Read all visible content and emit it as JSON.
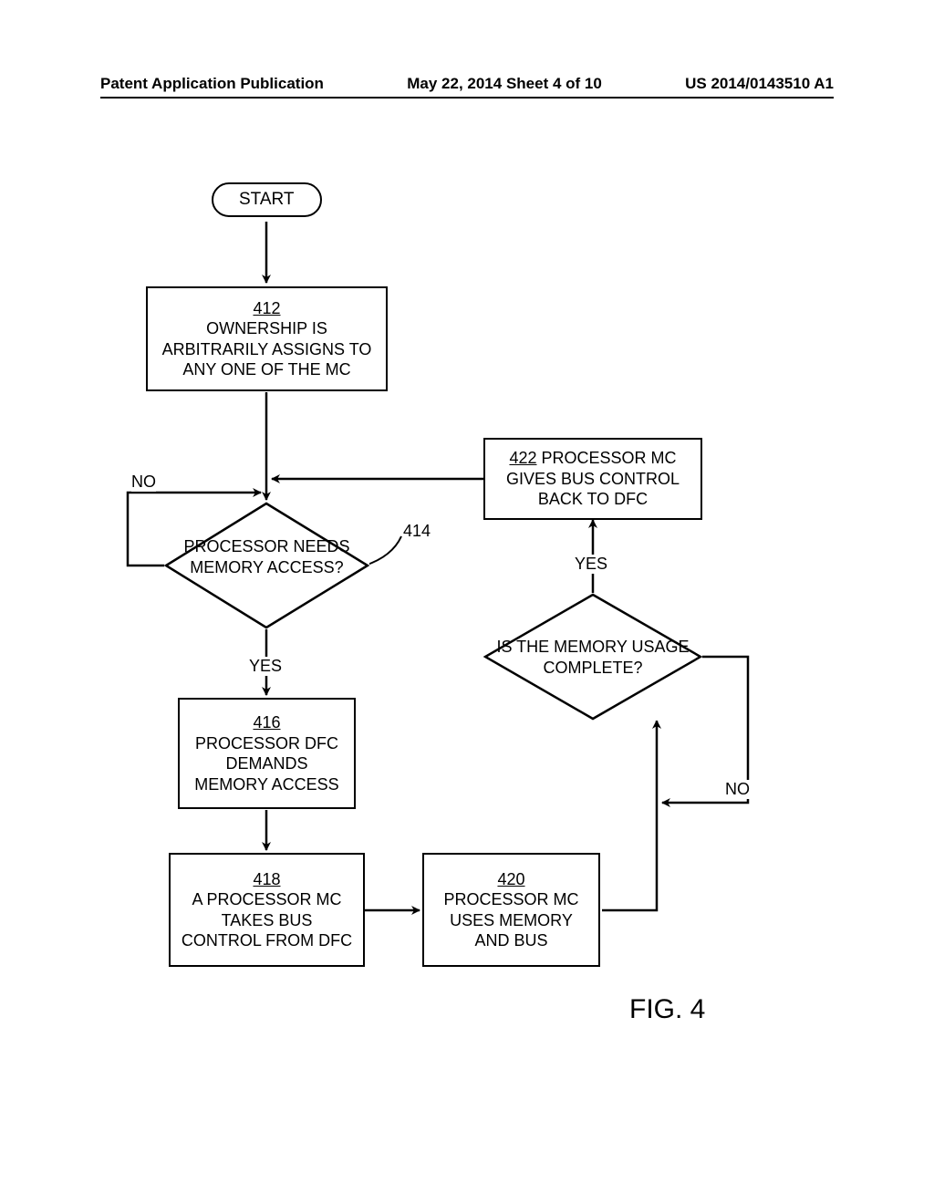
{
  "header": {
    "left": "Patent Application Publication",
    "center": "May 22, 2014  Sheet 4 of 10",
    "right": "US 2014/0143510 A1"
  },
  "start": {
    "label": "START"
  },
  "box412": {
    "ref": "412",
    "text": "OWNERSHIP IS ARBITRARILY ASSIGNS TO ANY ONE OF THE MC"
  },
  "d414": {
    "ref": "414",
    "text": "PROCESSOR NEEDS MEMORY ACCESS?"
  },
  "box416": {
    "ref": "416",
    "text": "PROCESSOR DFC DEMANDS MEMORY ACCESS"
  },
  "box418": {
    "ref": "418",
    "text": "A PROCESSOR MC TAKES BUS CONTROL FROM DFC"
  },
  "box420": {
    "ref": "420",
    "text": "PROCESSOR MC USES MEMORY AND BUS"
  },
  "d421": {
    "text": "IS THE MEMORY USAGE COMPLETE?"
  },
  "box422": {
    "ref": "422",
    "text": "PROCESSOR MC GIVES BUS CONTROL BACK TO DFC"
  },
  "labels": {
    "no1": "NO",
    "yes1": "YES",
    "no2": "NO",
    "yes2": "YES"
  },
  "figure": "FIG. 4"
}
